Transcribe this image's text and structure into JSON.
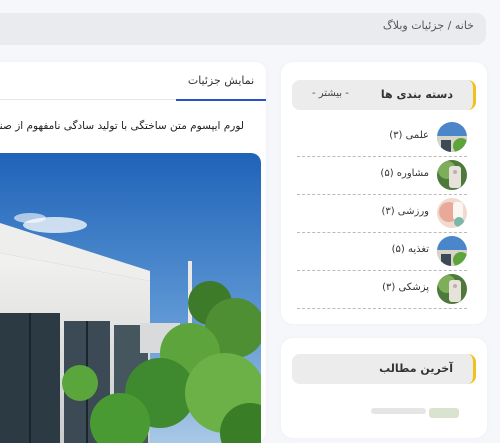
{
  "breadcrumb": {
    "home": "خانه",
    "separator": " / ",
    "current": "جزئیات وبلاگ"
  },
  "main": {
    "tab_label": "نمایش جزئیات",
    "intro": "لورم ایپسوم متن ساختگی با تولید سادگی نامفهوم از صنعت چ"
  },
  "categories": {
    "title": "دسته بندی ها",
    "more": "- بیشتر -",
    "items": [
      {
        "label": "علمی (۳)",
        "icon": "category-thumb-icon"
      },
      {
        "label": "مشاوره (۵)",
        "icon": "category-thumb-icon"
      },
      {
        "label": "ورزشی (۳)",
        "icon": "category-thumb-icon"
      },
      {
        "label": "تغذیه (۵)",
        "icon": "category-thumb-icon"
      },
      {
        "label": "پزشکی (۳)",
        "icon": "category-thumb-icon"
      }
    ]
  },
  "recent_posts": {
    "title": "آخرین مطالب"
  },
  "colors": {
    "accent": "#2855c6",
    "highlight": "#f1c21b",
    "panel": "#ececec"
  }
}
